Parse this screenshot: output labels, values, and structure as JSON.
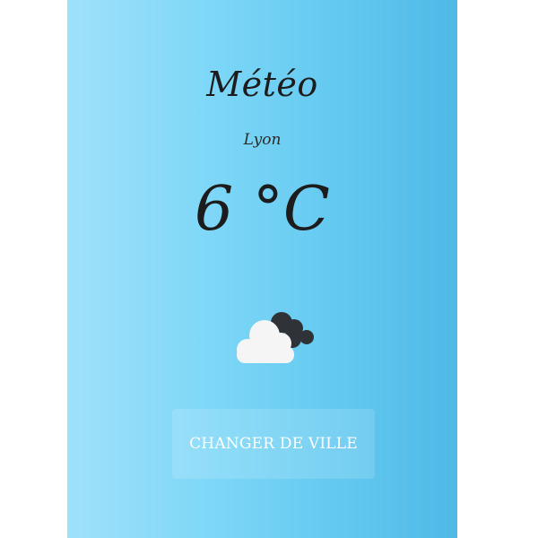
{
  "app": {
    "title": "Météo",
    "city": "Lyon",
    "temperature": "6 °C",
    "weather_icon": "cloudy-icon",
    "change_city_label": "CHANGER DE VILLE"
  },
  "colors": {
    "gradient_start": "#9fe1fb",
    "gradient_end": "#4fb8e6",
    "text": "#1c1c1c",
    "button_text": "#ffffff",
    "cloud_light": "#f5f5f5",
    "cloud_dark": "#2f3236"
  }
}
